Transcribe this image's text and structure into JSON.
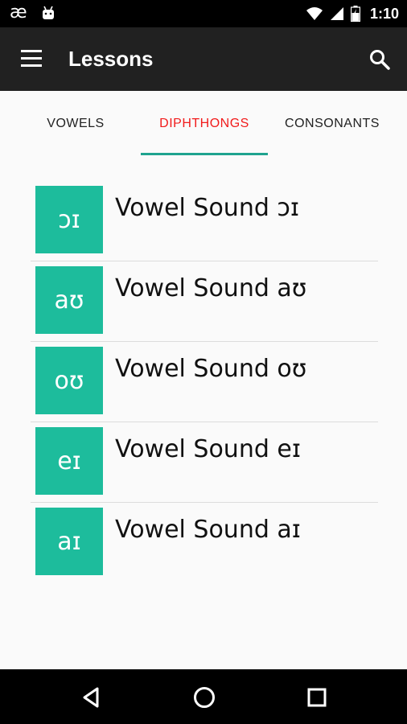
{
  "status_bar": {
    "app_glyph": "æ",
    "time": "1:10",
    "icons": [
      "android-icon",
      "wifi-icon",
      "signal-icon",
      "battery-icon"
    ]
  },
  "app_bar": {
    "title": "Lessons",
    "icons": [
      "menu-icon",
      "search-icon"
    ]
  },
  "tabs": [
    {
      "label": "VOWELS",
      "active": false
    },
    {
      "label": "DIPHTHONGS",
      "active": true
    },
    {
      "label": "CONSONANTS",
      "active": false
    }
  ],
  "lessons": [
    {
      "symbol": "ɔɪ",
      "title": "Vowel Sound ɔɪ"
    },
    {
      "symbol": "aʊ",
      "title": "Vowel Sound aʊ"
    },
    {
      "symbol": "oʊ",
      "title": "Vowel Sound oʊ"
    },
    {
      "symbol": "eɪ",
      "title": "Vowel Sound eɪ"
    },
    {
      "symbol": "aɪ",
      "title": "Vowel Sound aɪ"
    }
  ],
  "colors": {
    "accent": "#1dbc9c",
    "active_tab": "#f11b1b",
    "tab_indicator": "#1fa38f",
    "app_bar": "#212121"
  },
  "nav_bar": {
    "icons": [
      "back-icon",
      "home-icon",
      "recents-icon"
    ]
  }
}
